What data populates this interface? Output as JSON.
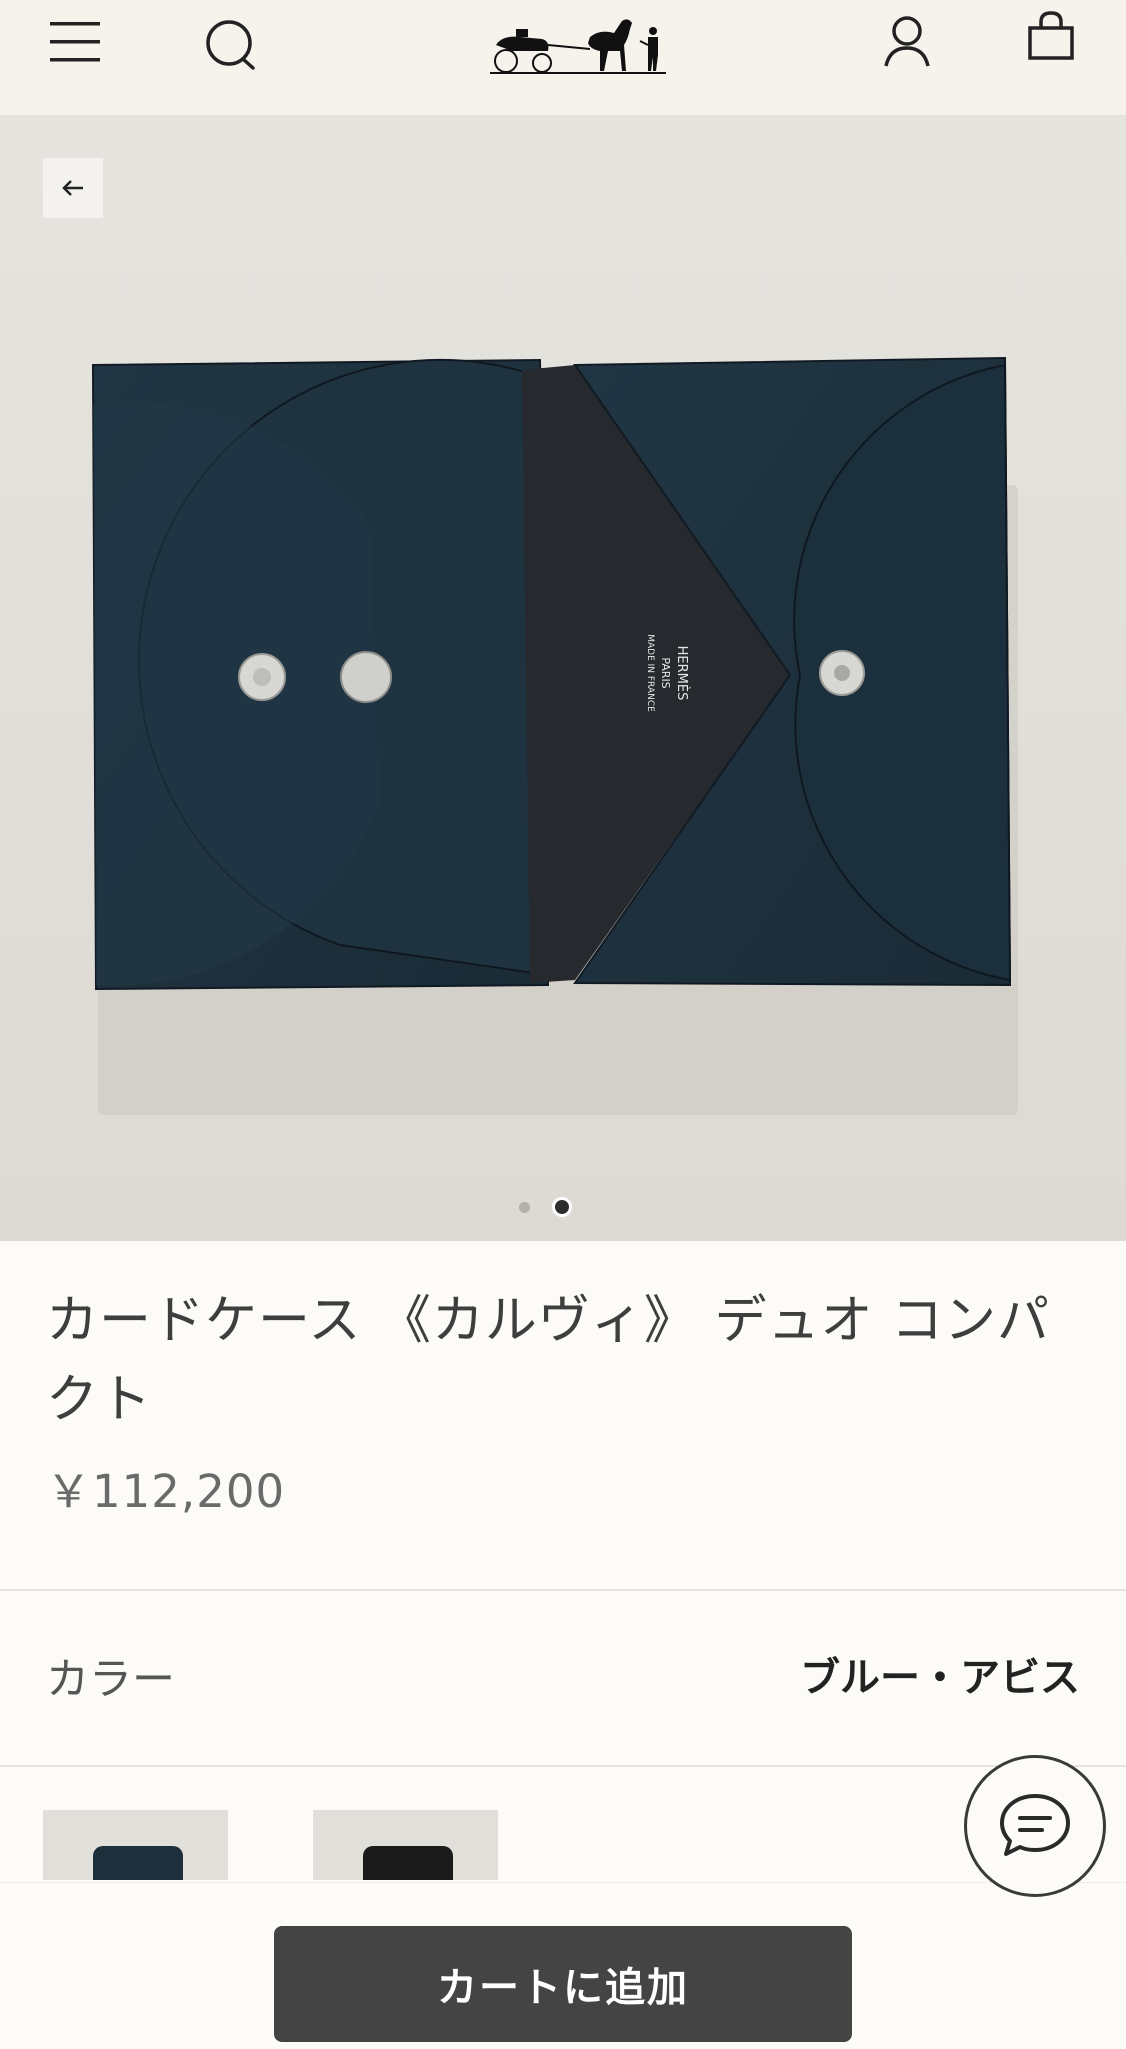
{
  "header": {
    "menu_icon": "hamburger-menu-icon",
    "search_icon": "search-icon",
    "logo_icon": "hermes-carriage-logo",
    "account_icon": "user-icon",
    "cart_icon": "shopping-bag-icon"
  },
  "gallery": {
    "back_icon": "arrow-left-icon",
    "image_label": "HERMÈS PARIS MADE IN FRANCE",
    "image_lines": [
      "HERMÈS",
      "PARIS",
      "MADE IN FRANCE"
    ],
    "page_index": 2,
    "page_count": 2
  },
  "product": {
    "title": "カードケース 《カルヴィ》 デュオ コンパクト",
    "price": "￥112,200"
  },
  "color": {
    "label": "カラー",
    "value": "ブルー・アビス",
    "swatches": [
      "#1d2f3b",
      "#1a1a1a"
    ]
  },
  "chat": {
    "icon": "chat-bubble-icon"
  },
  "cta": {
    "add_to_cart": "カートに追加"
  },
  "colors": {
    "header_bg": "#f6f2ec",
    "page_bg": "#fcfbf7",
    "hero_bg": "#e3e1dc",
    "leather": "#1f3341",
    "button_bg": "#444444"
  }
}
